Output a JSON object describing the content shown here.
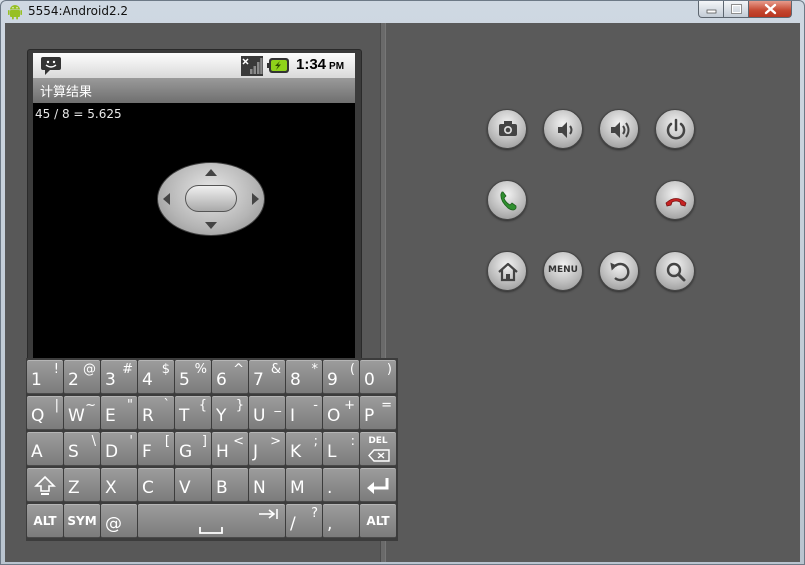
{
  "window": {
    "title": "5554:Android2.2",
    "controls": {
      "minimize": "minimize",
      "maximize": "maximize",
      "close": "close"
    }
  },
  "device": {
    "status_bar": {
      "time": "1:34",
      "ampm": "PM",
      "icons": [
        "notification-icon",
        "signal-icon",
        "battery-charging-icon"
      ]
    },
    "app_title": "计算结果",
    "content_text": "45 / 8 = 5.625"
  },
  "hardware_buttons": {
    "row1": [
      "camera-icon",
      "volume-down-icon",
      "volume-up-icon",
      "power-icon"
    ],
    "row2": [
      "call-icon",
      "dpad",
      "end-call-icon"
    ],
    "row3": [
      "home-icon",
      "MENU",
      "back-icon",
      "search-icon"
    ],
    "menu_label": "MENU"
  },
  "keyboard": {
    "rows": [
      [
        {
          "main": "1",
          "alt": "!"
        },
        {
          "main": "2",
          "alt": "@"
        },
        {
          "main": "3",
          "alt": "#"
        },
        {
          "main": "4",
          "alt": "$"
        },
        {
          "main": "5",
          "alt": "%"
        },
        {
          "main": "6",
          "alt": "^"
        },
        {
          "main": "7",
          "alt": "&"
        },
        {
          "main": "8",
          "alt": "*"
        },
        {
          "main": "9",
          "alt": "("
        },
        {
          "main": "0",
          "alt": ")"
        }
      ],
      [
        {
          "main": "Q",
          "alt": "|"
        },
        {
          "main": "W",
          "alt": "~"
        },
        {
          "main": "E",
          "alt": "\""
        },
        {
          "main": "R",
          "alt": "`"
        },
        {
          "main": "T",
          "alt": "{"
        },
        {
          "main": "Y",
          "alt": "}"
        },
        {
          "main": "U",
          "alt": "_"
        },
        {
          "main": "I",
          "alt": "-"
        },
        {
          "main": "O",
          "alt": "+"
        },
        {
          "main": "P",
          "alt": "="
        }
      ],
      [
        {
          "main": "A",
          "alt": ""
        },
        {
          "main": "S",
          "alt": "\\"
        },
        {
          "main": "D",
          "alt": "'"
        },
        {
          "main": "F",
          "alt": "["
        },
        {
          "main": "G",
          "alt": "]"
        },
        {
          "main": "H",
          "alt": "<"
        },
        {
          "main": "J",
          "alt": ">"
        },
        {
          "main": "K",
          "alt": ";"
        },
        {
          "main": "L",
          "alt": ":"
        },
        {
          "main": "DEL",
          "alt": ""
        }
      ],
      [
        {
          "main": "shift-icon",
          "alt": ""
        },
        {
          "main": "Z",
          "alt": ""
        },
        {
          "main": "X",
          "alt": ""
        },
        {
          "main": "C",
          "alt": ""
        },
        {
          "main": "V",
          "alt": ""
        },
        {
          "main": "B",
          "alt": ""
        },
        {
          "main": "N",
          "alt": ""
        },
        {
          "main": "M",
          "alt": ""
        },
        {
          "main": ".",
          "alt": ""
        },
        {
          "main": "enter-icon",
          "alt": ""
        }
      ],
      [
        {
          "main": "ALT",
          "alt": ""
        },
        {
          "main": "SYM",
          "alt": ""
        },
        {
          "main": "@",
          "alt": ""
        },
        {
          "main": "space-icon",
          "alt": "tab-icon"
        },
        {
          "main": "/",
          "alt": "?"
        },
        {
          "main": ",",
          "alt": ""
        },
        {
          "main": "ALT",
          "alt": ""
        }
      ]
    ],
    "labels": {
      "del": "DEL",
      "alt": "ALT",
      "sym": "SYM",
      "at": "@",
      "slash": "/",
      "question": "?",
      "comma": ",",
      "period": "."
    }
  }
}
